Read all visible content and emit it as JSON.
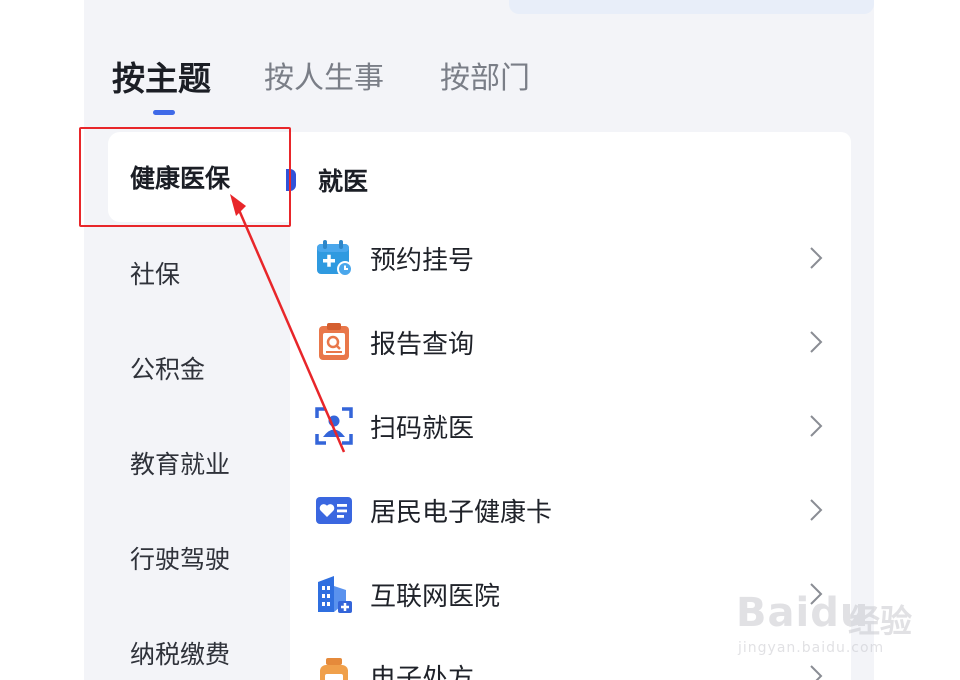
{
  "tabs": [
    {
      "label": "按主题",
      "active": true
    },
    {
      "label": "按人生事",
      "active": false
    },
    {
      "label": "按部门",
      "active": false
    }
  ],
  "sidebar": {
    "items": [
      {
        "label": "健康医保",
        "active": true
      },
      {
        "label": "社保",
        "active": false
      },
      {
        "label": "公积金",
        "active": false
      },
      {
        "label": "教育就业",
        "active": false
      },
      {
        "label": "行驶驾驶",
        "active": false
      },
      {
        "label": "纳税缴费",
        "active": false
      }
    ]
  },
  "content": {
    "section_title": "就医",
    "services": [
      {
        "label": "预约挂号",
        "icon": "calendar-clock-icon"
      },
      {
        "label": "报告查询",
        "icon": "clipboard-search-icon"
      },
      {
        "label": "扫码就医",
        "icon": "scan-person-icon"
      },
      {
        "label": "居民电子健康卡",
        "icon": "health-card-icon"
      },
      {
        "label": "互联网医院",
        "icon": "hospital-building-icon"
      },
      {
        "label": "电子处方",
        "icon": "medicine-bottle-icon"
      }
    ]
  },
  "watermark": {
    "logo": "Baidu",
    "text": "经验",
    "url": "jingyan.baidu.com"
  },
  "colors": {
    "accent": "#3f6ae8",
    "annotation": "#e8262a",
    "background": "#f3f4f8"
  }
}
